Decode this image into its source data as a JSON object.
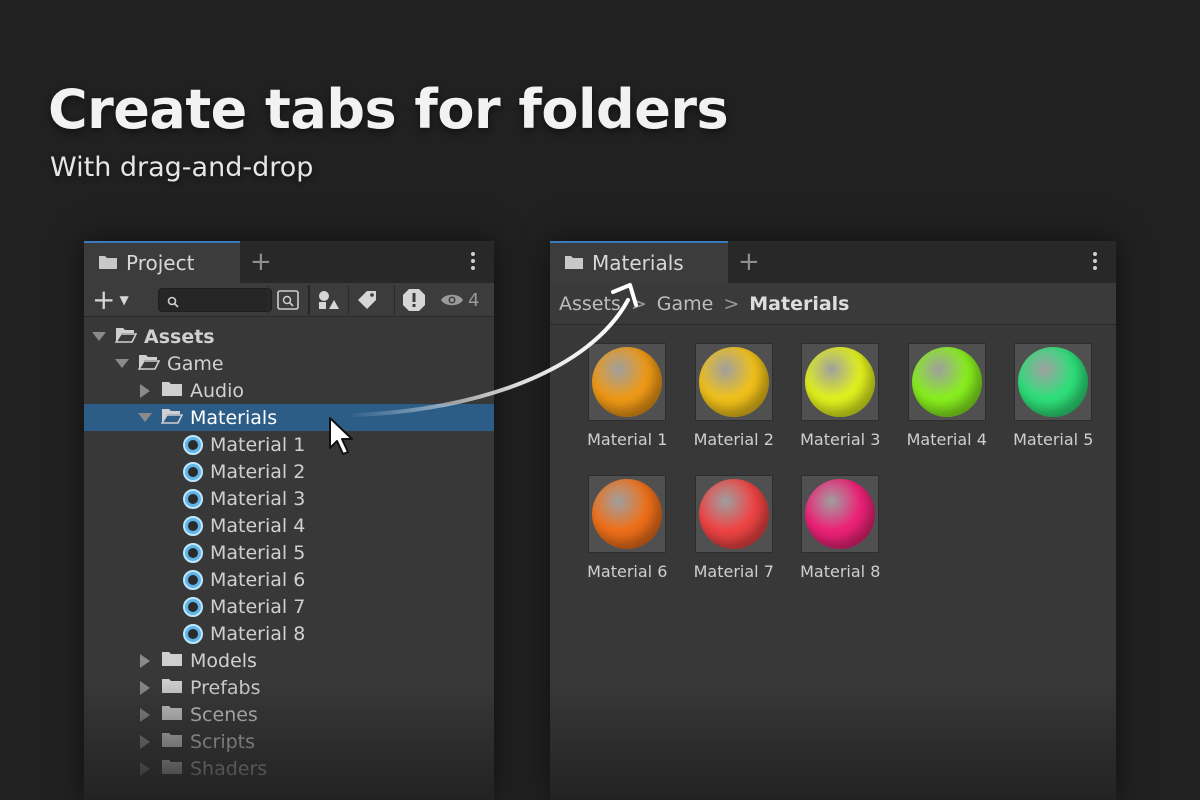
{
  "hero": {
    "title": "Create tabs for folders",
    "subtitle": "With drag-and-drop"
  },
  "project_panel": {
    "tab_label": "Project",
    "tab_icon": "folder-icon",
    "eye_count": "4",
    "tree": [
      {
        "label": "Assets",
        "depth": 0,
        "expanded": true,
        "bold": true,
        "icon": "folder-open-icon"
      },
      {
        "label": "Game",
        "depth": 1,
        "expanded": true,
        "icon": "folder-open-icon"
      },
      {
        "label": "Audio",
        "depth": 2,
        "expanded": false,
        "icon": "folder-icon"
      },
      {
        "label": "Materials",
        "depth": 2,
        "expanded": true,
        "selected": true,
        "icon": "folder-open-icon"
      },
      {
        "label": "Material 1",
        "depth": 3,
        "icon": "material-icon"
      },
      {
        "label": "Material 2",
        "depth": 3,
        "icon": "material-icon"
      },
      {
        "label": "Material 3",
        "depth": 3,
        "icon": "material-icon"
      },
      {
        "label": "Material 4",
        "depth": 3,
        "icon": "material-icon"
      },
      {
        "label": "Material 5",
        "depth": 3,
        "icon": "material-icon"
      },
      {
        "label": "Material 6",
        "depth": 3,
        "icon": "material-icon"
      },
      {
        "label": "Material 7",
        "depth": 3,
        "icon": "material-icon"
      },
      {
        "label": "Material 8",
        "depth": 3,
        "icon": "material-icon"
      },
      {
        "label": "Models",
        "depth": 2,
        "expanded": false,
        "icon": "folder-icon"
      },
      {
        "label": "Prefabs",
        "depth": 2,
        "expanded": false,
        "icon": "folder-icon"
      },
      {
        "label": "Scenes",
        "depth": 2,
        "expanded": false,
        "icon": "folder-icon"
      },
      {
        "label": "Scripts",
        "depth": 2,
        "expanded": false,
        "icon": "folder-icon"
      },
      {
        "label": "Shaders",
        "depth": 2,
        "expanded": false,
        "icon": "folder-icon"
      }
    ]
  },
  "materials_panel": {
    "tab_label": "Materials",
    "breadcrumbs": [
      "Assets",
      "Game",
      "Materials"
    ],
    "items": [
      {
        "name": "Material 1",
        "color": "#f09a16"
      },
      {
        "name": "Material 2",
        "color": "#f2c21a"
      },
      {
        "name": "Material 3",
        "color": "#e2f21e"
      },
      {
        "name": "Material 4",
        "color": "#88f01e"
      },
      {
        "name": "Material 5",
        "color": "#2ee07a"
      },
      {
        "name": "Material 6",
        "color": "#f0701a"
      },
      {
        "name": "Material 7",
        "color": "#f04444"
      },
      {
        "name": "Material 8",
        "color": "#ee2277"
      }
    ]
  }
}
